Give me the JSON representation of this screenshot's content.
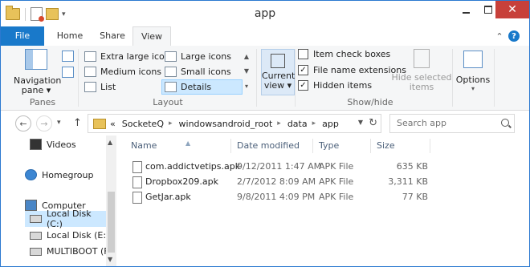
{
  "window": {
    "title": "app"
  },
  "tabs": [
    "File",
    "Home",
    "Share",
    "View"
  ],
  "ribbon": {
    "panes": {
      "nav_pane_label": "Navigation",
      "nav_pane_label2": "pane ▾",
      "group": "Panes"
    },
    "layout": {
      "options": [
        "Extra large icons",
        "Large icons",
        "Medium icons",
        "Small icons",
        "List",
        "Details"
      ],
      "selected": "Details",
      "group": "Layout"
    },
    "current_view": {
      "label": "Current",
      "label2": "view ▾"
    },
    "show_hide": {
      "item_check_boxes": {
        "label": "Item check boxes",
        "checked": false
      },
      "file_name_extensions": {
        "label": "File name extensions",
        "checked": true
      },
      "hidden_items": {
        "label": "Hidden items",
        "checked": true
      },
      "hide_selected": "Hide selected",
      "hide_selected2": "items",
      "group": "Show/hide"
    },
    "options": {
      "label": "Options"
    }
  },
  "address": {
    "crumbs": [
      "«",
      "SocketeQ",
      "windowsandroid_root",
      "data",
      "app"
    ],
    "search_placeholder": "Search app"
  },
  "nav": [
    {
      "label": "Videos"
    },
    {
      "label": "Homegroup"
    },
    {
      "label": "Computer"
    },
    {
      "label": "Local Disk (C:)"
    },
    {
      "label": "Local Disk (E:)"
    },
    {
      "label": "MULTIBOOT (F"
    }
  ],
  "columns": [
    "Name",
    "Date modified",
    "Type",
    "Size"
  ],
  "files": [
    {
      "name": "com.addictvetips.apk",
      "date": "9/12/2011 1:47 AM",
      "type": "APK File",
      "size": "635 KB"
    },
    {
      "name": "Dropbox209.apk",
      "date": "2/7/2012 8:09 AM",
      "type": "APK File",
      "size": "3,311 KB"
    },
    {
      "name": "GetJar.apk",
      "date": "9/8/2011 4:09 PM",
      "type": "APK File",
      "size": "77 KB"
    }
  ]
}
